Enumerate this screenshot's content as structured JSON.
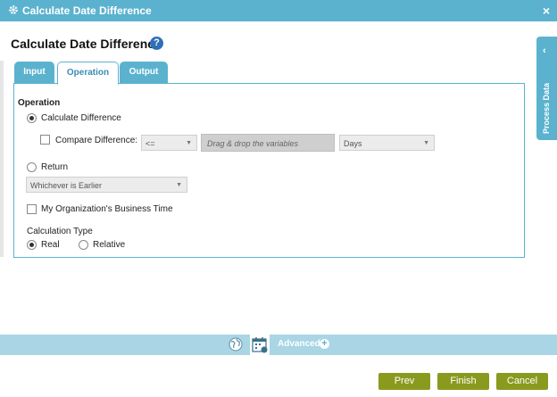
{
  "window": {
    "title": "Calculate Date Difference",
    "close_glyph": "×"
  },
  "page": {
    "heading": "Calculate Date Difference",
    "help_glyph": "?"
  },
  "tabs": [
    {
      "label": "Input",
      "active": false
    },
    {
      "label": "Operation",
      "active": true
    },
    {
      "label": "Output",
      "active": false
    }
  ],
  "operation": {
    "section_label": "Operation",
    "calculate_difference": {
      "label": "Calculate Difference",
      "selected": true
    },
    "compare_difference": {
      "label": "Compare Difference:",
      "checked": false,
      "operator_value": "<=",
      "dropzone_placeholder": "Drag & drop the variables",
      "unit_value": "Days"
    },
    "return": {
      "label": "Return",
      "selected": false,
      "dropdown_value": "Whichever is Earlier"
    },
    "business_time": {
      "label": "My Organization's Business Time",
      "checked": false
    },
    "calculation_type": {
      "label": "Calculation Type",
      "options": [
        {
          "label": "Real",
          "selected": true
        },
        {
          "label": "Relative",
          "selected": false
        }
      ]
    }
  },
  "side_panel": {
    "label": "Process Data",
    "chevron": "‹"
  },
  "bottom_bar": {
    "advanced_label": "Advanced",
    "plus_glyph": "+"
  },
  "footer": {
    "prev": "Prev",
    "finish": "Finish",
    "cancel": "Cancel"
  },
  "colors": {
    "accent": "#5bb2cf",
    "button": "#8a9a1e",
    "bottom_bar": "#a9d5e5"
  }
}
